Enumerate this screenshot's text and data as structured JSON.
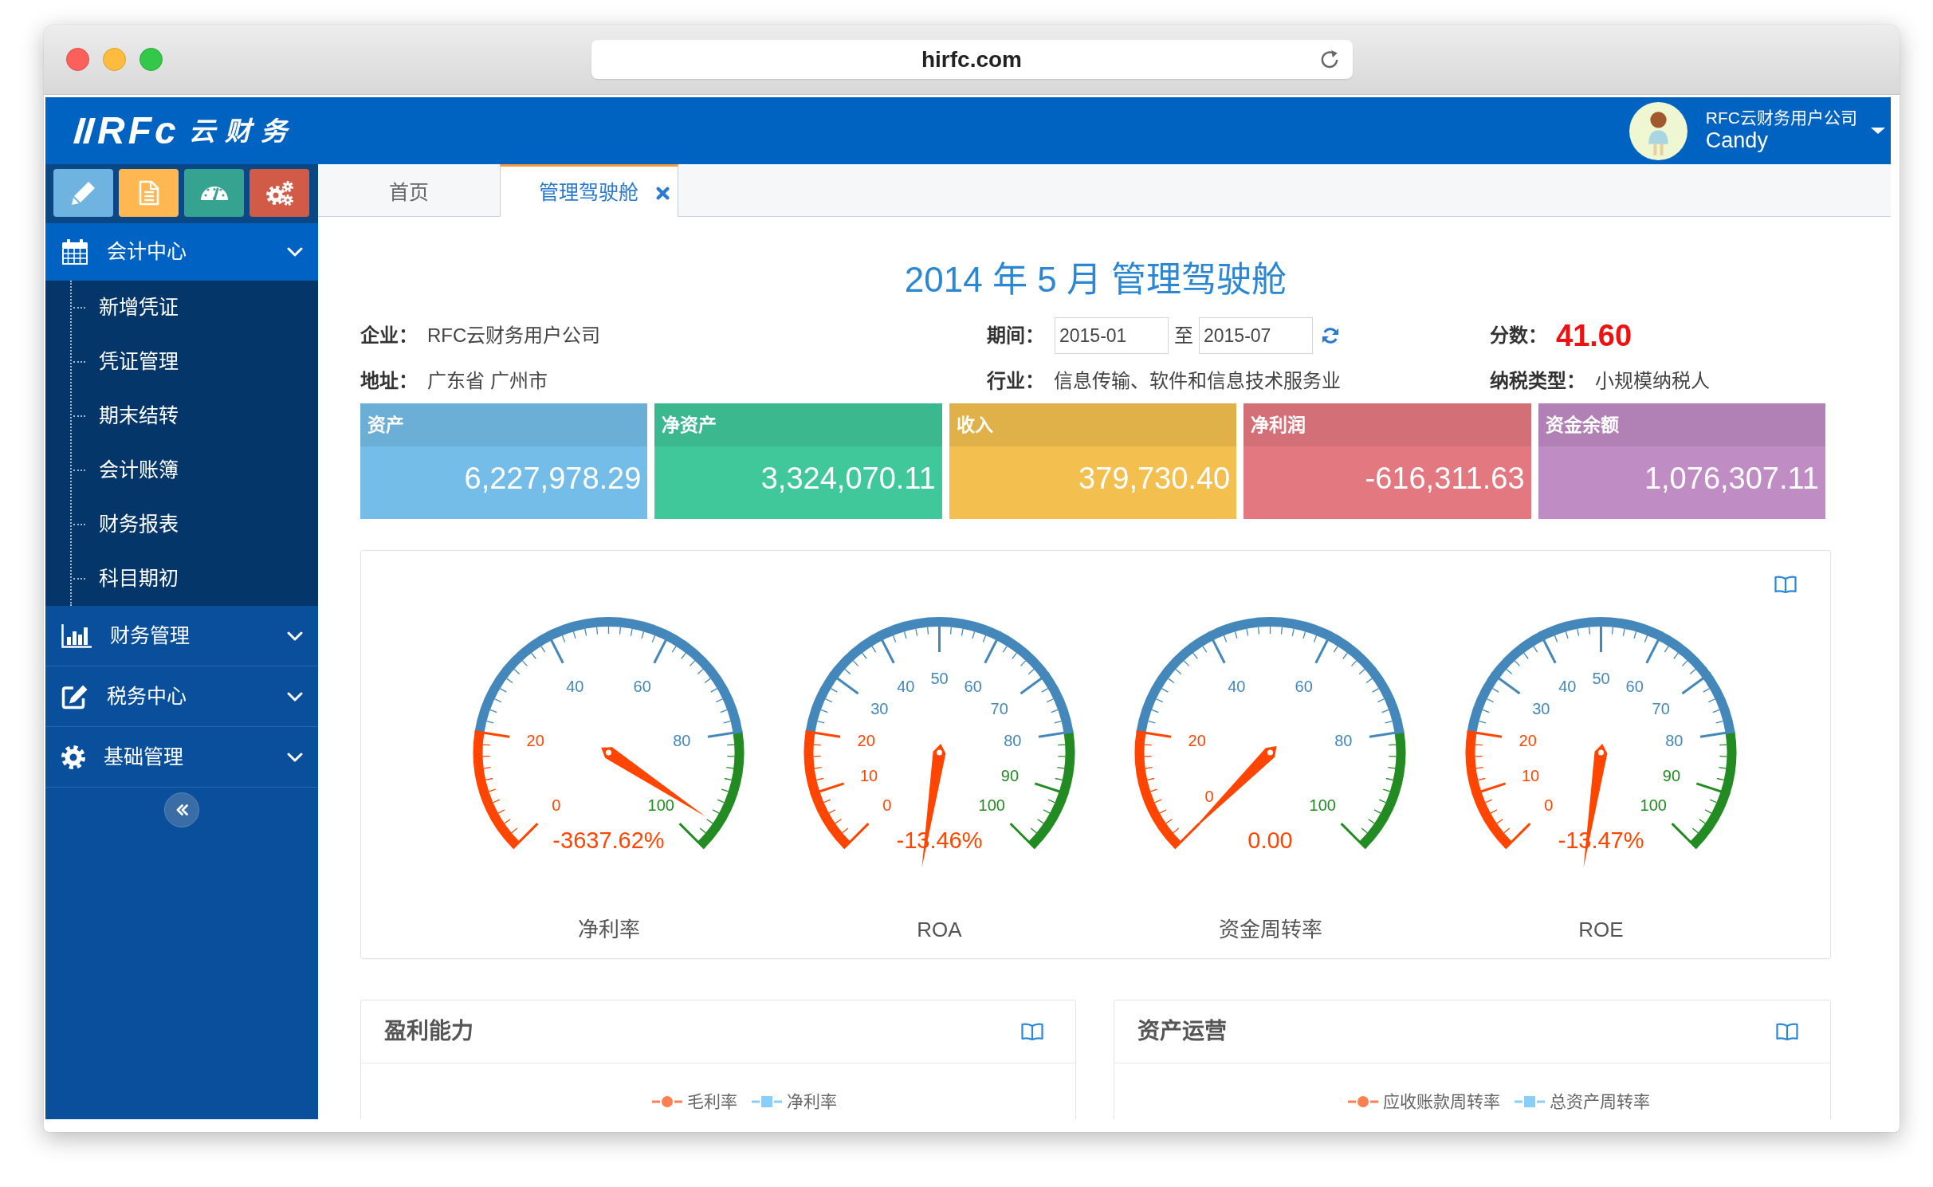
{
  "browser": {
    "url": "hirfc.com"
  },
  "header": {
    "logo": "RFc",
    "logo_subtitle": "云财务",
    "company": "RFC云财务用户公司",
    "user": "Candy"
  },
  "shortcuts": [
    {
      "kind": "edit",
      "color": "#6fb3e0"
    },
    {
      "kind": "document",
      "color": "#ffb752"
    },
    {
      "kind": "dashboard",
      "color": "#36a290"
    },
    {
      "kind": "settings",
      "color": "#d15b47"
    }
  ],
  "sidebar": {
    "items": [
      {
        "label": "会计中心",
        "kind": "calendar",
        "expanded": true,
        "children": [
          {
            "label": "新增凭证"
          },
          {
            "label": "凭证管理"
          },
          {
            "label": "期末结转"
          },
          {
            "label": "会计账簿"
          },
          {
            "label": "财务报表"
          },
          {
            "label": "科目期初"
          }
        ]
      },
      {
        "label": "财务管理",
        "kind": "chart",
        "expanded": false
      },
      {
        "label": "税务中心",
        "kind": "edit",
        "expanded": false
      },
      {
        "label": "基础管理",
        "kind": "settings",
        "expanded": false
      }
    ]
  },
  "tabs": [
    {
      "label": "首页",
      "selected": false,
      "closable": false
    },
    {
      "label": "管理驾驶舱",
      "selected": true,
      "closable": true
    }
  ],
  "dashboard": {
    "title": "2014 年 5 月 管理驾驶舱",
    "info": [
      {
        "kind": "text",
        "label": "企业：",
        "value": "RFC云财务用户公司"
      },
      {
        "kind": "range",
        "label": "期间：",
        "from": "2015-01",
        "separator": "至",
        "to": "2015-07"
      },
      {
        "kind": "score",
        "label": "分数：",
        "value": "41.60"
      },
      {
        "kind": "text",
        "label": "地址：",
        "value": "广东省 广州市"
      },
      {
        "kind": "text",
        "label": "行业：",
        "value": "信息传输、软件和信息技术服务业"
      },
      {
        "kind": "text",
        "label": "纳税类型：",
        "value": "小规模纳税人"
      }
    ],
    "metrics": [
      {
        "label": "资产",
        "value": "6,227,978.29",
        "color": "#74bde8"
      },
      {
        "label": "净资产",
        "value": "3,324,070.11",
        "color": "#40c79a"
      },
      {
        "label": "收入",
        "value": "379,730.40",
        "color": "#f3bf4f"
      },
      {
        "label": "净利润",
        "value": "-616,311.63",
        "color": "#e47880"
      },
      {
        "label": "资金余额",
        "value": "1,076,307.11",
        "color": "#c08cc4"
      }
    ],
    "gauges": [
      {
        "title": "净利率",
        "reading": "-3637.62%",
        "ticks": [
          "0",
          "20",
          "40",
          "60",
          "80",
          "100"
        ]
      },
      {
        "title": "ROA",
        "reading": "-13.46%",
        "ticks": [
          "0",
          "10",
          "20",
          "30",
          "40",
          "50",
          "60",
          "70",
          "80",
          "90",
          "100"
        ]
      },
      {
        "title": "资金周转率",
        "reading": "0.00",
        "ticks": [
          "0",
          "20",
          "40",
          "60",
          "80",
          "100"
        ]
      },
      {
        "title": "ROE",
        "reading": "-13.47%",
        "ticks": [
          "0",
          "10",
          "20",
          "30",
          "40",
          "50",
          "60",
          "70",
          "80",
          "90",
          "100"
        ]
      }
    ],
    "panels": [
      {
        "title": "盈利能力",
        "legend": [
          {
            "label": "毛利率",
            "kind": "circle",
            "color": "#ff7f50"
          },
          {
            "label": "净利率",
            "kind": "square",
            "color": "#87cefa"
          }
        ]
      },
      {
        "title": "资产运营",
        "legend": [
          {
            "label": "应收账款周转率",
            "kind": "circle",
            "color": "#ff7f50"
          },
          {
            "label": "总资产周转率",
            "kind": "square",
            "color": "#87cefa"
          }
        ]
      }
    ]
  }
}
